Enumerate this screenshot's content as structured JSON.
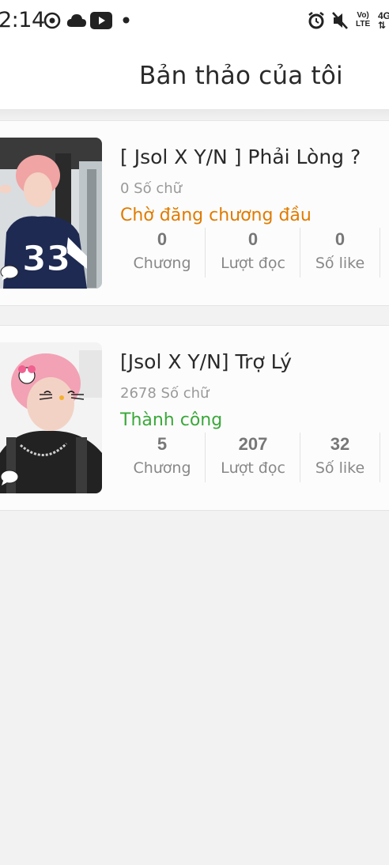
{
  "status_bar": {
    "time": "2:14",
    "network_label_top": "Vo)",
    "network_label_bottom": "LTE",
    "signal_label": "4G"
  },
  "header": {
    "title": "Bản thảo của tôi"
  },
  "drafts": [
    {
      "title": "[ Jsol X Y/N ] Phải Lòng ?",
      "word_count": "0 Số chữ",
      "status": "Chờ đăng chương đầu",
      "status_color": "#e07b00",
      "stats": [
        {
          "value": "0",
          "label": "Chương"
        },
        {
          "value": "0",
          "label": "Lượt đọc"
        },
        {
          "value": "0",
          "label": "Số like"
        }
      ]
    },
    {
      "title": "[Jsol X Y/N] Trợ Lý",
      "word_count": "2678 Số chữ",
      "status": "Thành công",
      "status_color": "#3aa83a",
      "stats": [
        {
          "value": "5",
          "label": "Chương"
        },
        {
          "value": "207",
          "label": "Lượt đọc"
        },
        {
          "value": "32",
          "label": "Số like"
        }
      ]
    }
  ]
}
